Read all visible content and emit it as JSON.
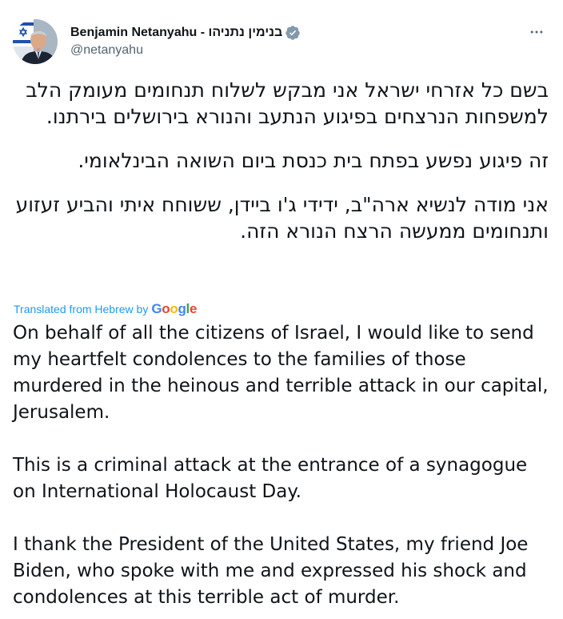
{
  "author": {
    "display_name": "Benjamin Netanyahu - בנימין נתניהו",
    "handle": "@netanyahu",
    "verified": true,
    "avatar_icon": "profile-photo-with-israeli-flag"
  },
  "menu": {
    "icon": "more-horizontal-icon"
  },
  "tweet": {
    "hebrew_paragraphs": [
      "בשם כל אזרחי ישראל אני מבקש לשלוח תנחומים מעומק הלב למשפחות הנרצחים בפיגוע הנתעב והנורא בירושלים בירתנו.",
      "זה פיגוע נפשע בפתח בית כנסת ביום השואה הבינלאומי.",
      "אני מודה לנשיא ארה\"ב, ידידי ג'ו ביידן, ששוחח איתי והביע זעזוע ותנחומים ממעשה הרצח הנורא הזה."
    ],
    "translation_label": "Translated from Hebrew by",
    "translation_provider": "Google",
    "english_paragraphs": [
      "On behalf of all the citizens of Israel, I would like to send my heartfelt condolences to the families of those murdered in the heinous and terrible attack in our capital, Jerusalem.",
      "This is a criminal attack at the entrance of a synagogue on International Holocaust Day.",
      "I thank the President of the United States, my friend Joe Biden, who spoke with me and expressed his shock and condolences at this terrible act of murder."
    ]
  },
  "colors": {
    "text_primary": "#0f1419",
    "text_secondary": "#536471",
    "link_blue": "#1d9bf0",
    "verified_badge": "#829aab",
    "google_blue": "#4285F4",
    "google_red": "#EA4335",
    "google_yellow": "#FBBC05",
    "google_green": "#34A853"
  }
}
